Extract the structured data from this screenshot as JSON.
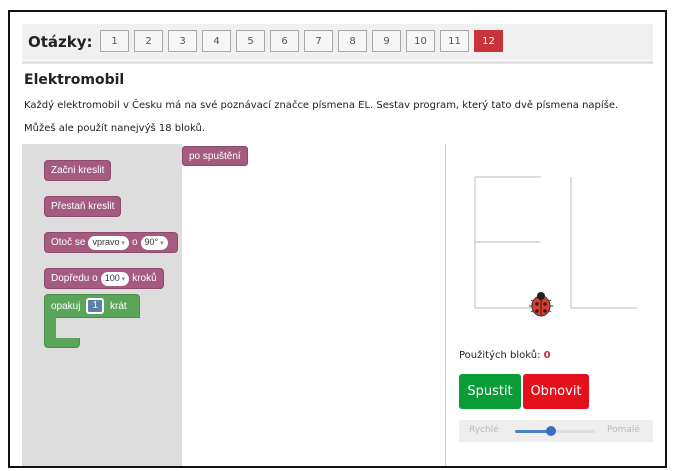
{
  "header": {
    "label": "Otázky:",
    "questions": [
      "1",
      "2",
      "3",
      "4",
      "5",
      "6",
      "7",
      "8",
      "9",
      "10",
      "11",
      "12"
    ],
    "active_question": "12"
  },
  "task": {
    "title": "Elektromobil",
    "description": "Každý elektromobil v Česku má na své poznávací značce písmena EL. Sestav program, který tato dvě písmena napíše.",
    "limit": "Můžeš ale použít nanejvýš 18 bloků."
  },
  "toolbox": {
    "start_draw": "Začni kreslit",
    "stop_draw": "Přestaň kreslit",
    "turn_prefix": "Otoč se",
    "turn_direction": "vpravo",
    "turn_mid": "o",
    "turn_angle": "90°",
    "forward_prefix": "Dopředu o",
    "forward_value": "100",
    "forward_suffix": "kroků",
    "repeat_prefix": "opakuj",
    "repeat_value": "1",
    "repeat_suffix": "krát"
  },
  "workspace": {
    "hat_block": "po spuštění"
  },
  "output": {
    "used_label": "Použitých bloků:",
    "used_value": "0",
    "run_button": "Spustit",
    "reset_button": "Obnovit",
    "speed_fast": "Rychlé",
    "speed_slow": "Pomalé",
    "speed_level": 0.45
  },
  "colors": {
    "active_question": "#c9333a",
    "draw_block": "#a55b80",
    "loop_block": "#5ba55b",
    "run_button": "#0a9c37",
    "reset_button": "#e5101b",
    "used_count": "#c9333a"
  },
  "icons": {
    "turtle": "ladybug-icon"
  }
}
